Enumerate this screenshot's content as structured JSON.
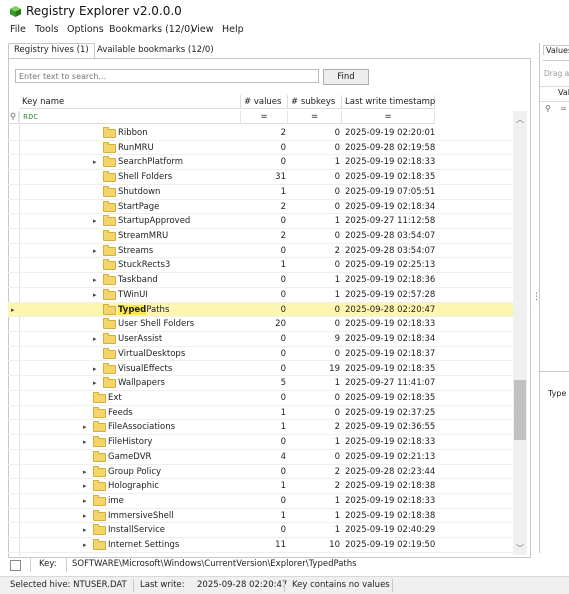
{
  "app": {
    "title": "Registry Explorer v2.0.0.0"
  },
  "menu": [
    "File",
    "Tools",
    "Options",
    "Bookmarks (12/0)",
    "View",
    "Help"
  ],
  "tabs": {
    "hives": "Registry hives (1)",
    "bookmarks": "Available bookmarks (12/0)"
  },
  "search": {
    "placeholder": "Enter text to search...",
    "find_label": "Find"
  },
  "columns": {
    "key_name": "Key name",
    "values": "# values",
    "subkeys": "# subkeys",
    "timestamp": "Last write timestamp"
  },
  "filter": {
    "key_name": "🄰C",
    "values": "=",
    "subkeys": "=",
    "timestamp": "="
  },
  "rows": [
    {
      "name": "Ribbon",
      "values": "2",
      "subkeys": "0",
      "ts": "2025-09-19 02:20:01",
      "expand": false,
      "indent": 2
    },
    {
      "name": "RunMRU",
      "values": "0",
      "subkeys": "0",
      "ts": "2025-09-28 02:19:58",
      "expand": false,
      "indent": 2
    },
    {
      "name": "SearchPlatform",
      "values": "0",
      "subkeys": "1",
      "ts": "2025-09-19 02:18:33",
      "expand": true,
      "indent": 2
    },
    {
      "name": "Shell Folders",
      "values": "31",
      "subkeys": "0",
      "ts": "2025-09-19 02:18:35",
      "expand": false,
      "indent": 2
    },
    {
      "name": "Shutdown",
      "values": "1",
      "subkeys": "0",
      "ts": "2025-09-19 07:05:51",
      "expand": false,
      "indent": 2
    },
    {
      "name": "StartPage",
      "values": "2",
      "subkeys": "0",
      "ts": "2025-09-19 02:18:34",
      "expand": false,
      "indent": 2
    },
    {
      "name": "StartupApproved",
      "values": "0",
      "subkeys": "1",
      "ts": "2025-09-27 11:12:58",
      "expand": true,
      "indent": 2
    },
    {
      "name": "StreamMRU",
      "values": "2",
      "subkeys": "0",
      "ts": "2025-09-28 03:54:07",
      "expand": false,
      "indent": 2
    },
    {
      "name": "Streams",
      "values": "0",
      "subkeys": "2",
      "ts": "2025-09-28 03:54:07",
      "expand": true,
      "indent": 2
    },
    {
      "name": "StuckRects3",
      "values": "1",
      "subkeys": "0",
      "ts": "2025-09-19 02:25:13",
      "expand": false,
      "indent": 2
    },
    {
      "name": "Taskband",
      "values": "0",
      "subkeys": "1",
      "ts": "2025-09-19 02:18:36",
      "expand": true,
      "indent": 2
    },
    {
      "name": "TWinUI",
      "values": "0",
      "subkeys": "1",
      "ts": "2025-09-19 02:57:28",
      "expand": true,
      "indent": 2
    },
    {
      "name": "TypedPaths",
      "values": "0",
      "subkeys": "0",
      "ts": "2025-09-28 02:20:47",
      "expand": false,
      "indent": 2,
      "selected": true,
      "highlight": "Typed"
    },
    {
      "name": "User Shell Folders",
      "values": "20",
      "subkeys": "0",
      "ts": "2025-09-19 02:18:33",
      "expand": false,
      "indent": 2
    },
    {
      "name": "UserAssist",
      "values": "0",
      "subkeys": "9",
      "ts": "2025-09-19 02:18:34",
      "expand": true,
      "indent": 2
    },
    {
      "name": "VirtualDesktops",
      "values": "0",
      "subkeys": "0",
      "ts": "2025-09-19 02:18:37",
      "expand": false,
      "indent": 2
    },
    {
      "name": "VisualEffects",
      "values": "0",
      "subkeys": "19",
      "ts": "2025-09-19 02:18:35",
      "expand": true,
      "indent": 2
    },
    {
      "name": "Wallpapers",
      "values": "5",
      "subkeys": "1",
      "ts": "2025-09-27 11:41:07",
      "expand": true,
      "indent": 2
    },
    {
      "name": "Ext",
      "values": "0",
      "subkeys": "0",
      "ts": "2025-09-19 02:18:35",
      "expand": false,
      "indent": 1
    },
    {
      "name": "Feeds",
      "values": "1",
      "subkeys": "0",
      "ts": "2025-09-19 02:37:25",
      "expand": false,
      "indent": 1
    },
    {
      "name": "FileAssociations",
      "values": "1",
      "subkeys": "2",
      "ts": "2025-09-19 02:36:55",
      "expand": true,
      "indent": 1
    },
    {
      "name": "FileHistory",
      "values": "0",
      "subkeys": "1",
      "ts": "2025-09-19 02:18:33",
      "expand": true,
      "indent": 1
    },
    {
      "name": "GameDVR",
      "values": "4",
      "subkeys": "0",
      "ts": "2025-09-19 02:21:13",
      "expand": false,
      "indent": 1
    },
    {
      "name": "Group Policy",
      "values": "0",
      "subkeys": "2",
      "ts": "2025-09-28 02:23:44",
      "expand": true,
      "indent": 1
    },
    {
      "name": "Holographic",
      "values": "1",
      "subkeys": "2",
      "ts": "2025-09-19 02:18:38",
      "expand": true,
      "indent": 1
    },
    {
      "name": "ime",
      "values": "0",
      "subkeys": "1",
      "ts": "2025-09-19 02:18:33",
      "expand": true,
      "indent": 1
    },
    {
      "name": "ImmersiveShell",
      "values": "1",
      "subkeys": "1",
      "ts": "2025-09-19 02:18:38",
      "expand": true,
      "indent": 1
    },
    {
      "name": "InstallService",
      "values": "0",
      "subkeys": "1",
      "ts": "2025-09-19 02:40:29",
      "expand": true,
      "indent": 1
    },
    {
      "name": "Internet Settings",
      "values": "11",
      "subkeys": "10",
      "ts": "2025-09-19 02:19:50",
      "expand": true,
      "indent": 1
    }
  ],
  "right_panel": {
    "tab": "Values",
    "drag_hint": "Drag a",
    "col": "Val",
    "type_label": "Type"
  },
  "keybar": {
    "label": "Key:",
    "path": "SOFTWARE\\Microsoft\\Windows\\CurrentVersion\\Explorer\\TypedPaths"
  },
  "status": {
    "hive": "Selected hive: NTUSER.DAT",
    "last_write_label": "Last write:",
    "last_write": "2025-09-28 02:20:47",
    "msg": "Key contains no values"
  },
  "colors": {
    "selected_row": "#fcf6b0",
    "folder": "#f3d56a",
    "accent": "#2e7d32"
  }
}
